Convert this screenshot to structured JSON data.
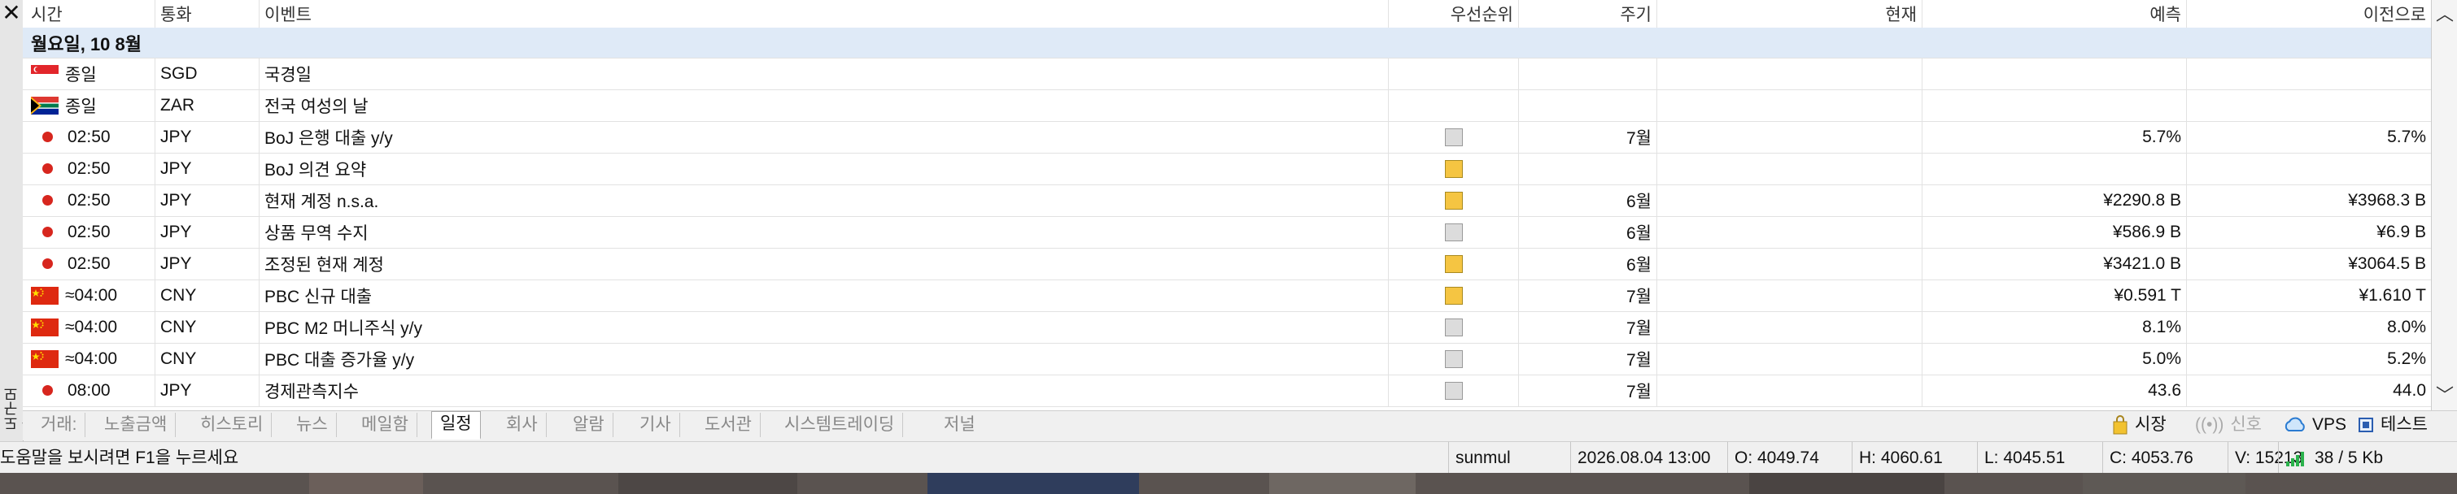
{
  "columns": {
    "time": "시간",
    "currency": "통화",
    "event": "이벤트",
    "priority": "우선순위",
    "period": "주기",
    "actual": "현재",
    "forecast": "예측",
    "previous": "이전으로"
  },
  "day_header": "월요일, 10 8월",
  "rows": [
    {
      "time": "종일",
      "marker": "flag-sg",
      "currency": "SGD",
      "event": "국경일",
      "priority": "",
      "period": "",
      "actual": "",
      "forecast": "",
      "previous": ""
    },
    {
      "time": "종일",
      "marker": "flag-za",
      "currency": "ZAR",
      "event": "전국 여성의 날",
      "priority": "",
      "period": "",
      "actual": "",
      "forecast": "",
      "previous": ""
    },
    {
      "time": "02:50",
      "marker": "red-dot",
      "currency": "JPY",
      "event": "BoJ 은행 대출 y/y",
      "priority": "low",
      "period": "7월",
      "actual": "",
      "forecast": "5.7%",
      "previous": "5.7%"
    },
    {
      "time": "02:50",
      "marker": "red-dot",
      "currency": "JPY",
      "event": "BoJ 의견 요약",
      "priority": "medium",
      "period": "",
      "actual": "",
      "forecast": "",
      "previous": ""
    },
    {
      "time": "02:50",
      "marker": "red-dot",
      "currency": "JPY",
      "event": "현재 계정 n.s.a.",
      "priority": "medium",
      "period": "6월",
      "actual": "",
      "forecast": "¥2290.8 B",
      "previous": "¥3968.3 B"
    },
    {
      "time": "02:50",
      "marker": "red-dot",
      "currency": "JPY",
      "event": "상품 무역 수지",
      "priority": "low",
      "period": "6월",
      "actual": "",
      "forecast": "¥586.9 B",
      "previous": "¥6.9 B"
    },
    {
      "time": "02:50",
      "marker": "red-dot",
      "currency": "JPY",
      "event": "조정된 현재 계정",
      "priority": "medium",
      "period": "6월",
      "actual": "",
      "forecast": "¥3421.0 B",
      "previous": "¥3064.5 B"
    },
    {
      "time": "≈04:00",
      "marker": "flag-cn",
      "currency": "CNY",
      "event": "PBC 신규 대출",
      "priority": "medium",
      "period": "7월",
      "actual": "",
      "forecast": "¥0.591 T",
      "previous": "¥1.610 T"
    },
    {
      "time": "≈04:00",
      "marker": "flag-cn",
      "currency": "CNY",
      "event": "PBC M2 머니주식 y/y",
      "priority": "low",
      "period": "7월",
      "actual": "",
      "forecast": "8.1%",
      "previous": "8.0%"
    },
    {
      "time": "≈04:00",
      "marker": "flag-cn",
      "currency": "CNY",
      "event": "PBC 대출 증가율 y/y",
      "priority": "low",
      "period": "7월",
      "actual": "",
      "forecast": "5.0%",
      "previous": "5.2%"
    },
    {
      "time": "08:00",
      "marker": "red-dot",
      "currency": "JPY",
      "event": "경제관측지수",
      "priority": "low",
      "period": "7월",
      "actual": "",
      "forecast": "43.6",
      "previous": "44.0"
    }
  ],
  "tabs": [
    "거래:",
    "노출금액",
    "히스토리",
    "뉴스",
    "메일함",
    "일정",
    "회사",
    "알람",
    "기사",
    "도서관",
    "시스템트레이딩",
    "저널"
  ],
  "active_tab": "일정",
  "tab_right": {
    "market": "시장",
    "signals": "신호",
    "vps": "VPS",
    "tester": "테스트"
  },
  "side_label": "도구모음",
  "close_glyph": "✕",
  "status": {
    "help": "도움말을 보시려면 F1을 누르세요",
    "profile": "sunmul",
    "datetime": "2026.08.04 13:00",
    "open": "O: 4049.74",
    "high": "H: 4060.61",
    "low": "L: 4045.51",
    "close": "C: 4053.76",
    "volume": "V: 15213",
    "connection": "38 / 5 Kb"
  },
  "colors": {
    "day_header_bg": "#dfeaf7",
    "medium_priority": "#f5c542",
    "low_priority": "#dcdcdc",
    "red_dot": "#d7261e",
    "connection_green": "#2bb24c"
  }
}
